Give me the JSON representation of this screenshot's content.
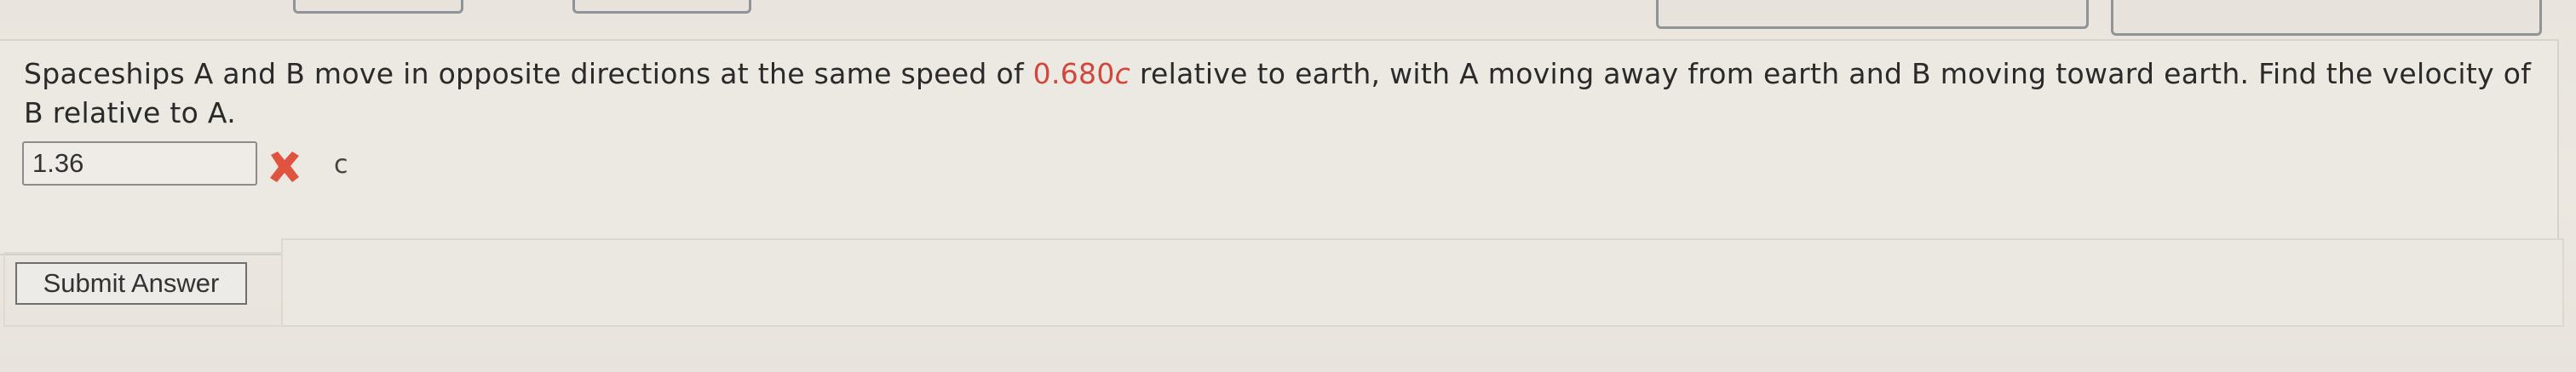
{
  "question": {
    "text_before": "Spaceships A and B move in opposite directions at the same speed of ",
    "speed_value": "0.680",
    "speed_unit": "c",
    "text_after": " relative to earth, with A moving away from earth and B moving toward earth. Find the velocity of B relative to A."
  },
  "answer": {
    "value": "1.36",
    "unit": "c",
    "status": "incorrect"
  },
  "status_icon": "x-mark-icon",
  "submit": {
    "label": "Submit Answer"
  },
  "colors": {
    "highlight": "#d2473b",
    "wrong": "#e0533f"
  }
}
